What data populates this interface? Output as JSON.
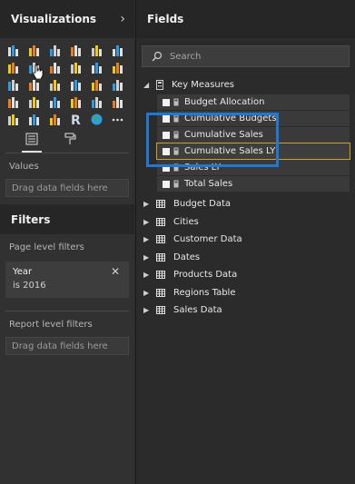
{
  "visualizations": {
    "title": "Visualizations",
    "icons": [
      "stacked-bar-icon",
      "stacked-column-icon",
      "clustered-bar-icon",
      "clustered-column-icon",
      "100-stacked-bar-icon",
      "100-stacked-column-icon",
      "line-chart-icon",
      "area-chart-icon",
      "stacked-area-icon",
      "line-column-icon",
      "line-clustered-column-icon",
      "ribbon-chart-icon",
      "waterfall-icon",
      "scatter-icon",
      "pie-icon",
      "donut-icon",
      "treemap-icon",
      "map-icon",
      "filled-map-icon",
      "funnel-icon",
      "gauge-icon",
      "card-icon",
      "multi-row-card-icon",
      "kpi-icon",
      "slicer-icon",
      "table-icon",
      "matrix-icon",
      "r-visual-icon",
      "globe-icon",
      "more-icon"
    ],
    "values_label": "Values",
    "values_placeholder": "Drag data fields here"
  },
  "filters": {
    "title": "Filters",
    "page_level_label": "Page level filters",
    "page_filter": {
      "name": "Year",
      "value": "is 2016",
      "close": "✕"
    },
    "report_level_label": "Report level filters",
    "report_placeholder": "Drag data fields here"
  },
  "fields": {
    "title": "Fields",
    "search_placeholder": "Search",
    "key_measures": {
      "label": "Key Measures",
      "items": [
        {
          "label": "Budget Allocation"
        },
        {
          "label": "Cumulative Budgets"
        },
        {
          "label": "Cumulative Sales"
        },
        {
          "label": "Cumulative Sales LY"
        },
        {
          "label": "Sales LY"
        },
        {
          "label": "Total Sales"
        }
      ]
    },
    "tables": [
      {
        "label": "Budget Data"
      },
      {
        "label": "Cities"
      },
      {
        "label": "Customer Data"
      },
      {
        "label": "Dates"
      },
      {
        "label": "Products Data"
      },
      {
        "label": "Regions Table"
      },
      {
        "label": "Sales Data"
      }
    ]
  },
  "colors": {
    "highlight_box": "#1f78d1",
    "selected_outline": "#c9a227"
  }
}
